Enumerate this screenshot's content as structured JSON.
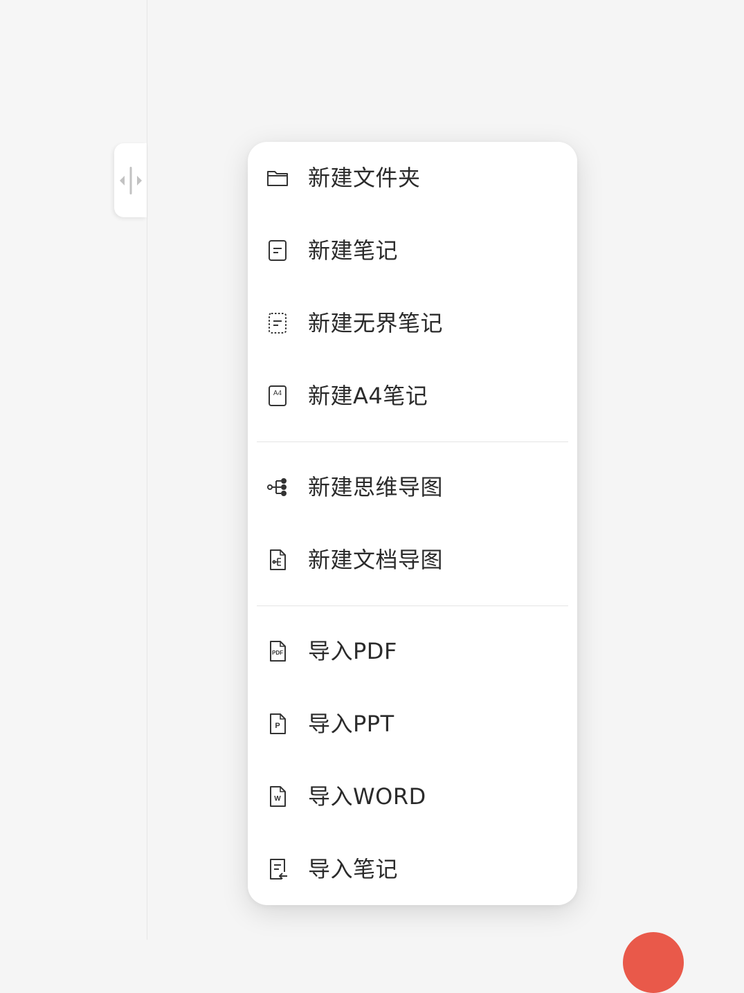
{
  "sidebar": {
    "handle_icon": "resize-handle-icon"
  },
  "menu": {
    "items": [
      {
        "label": "新建文件夹",
        "icon": "folder-icon"
      },
      {
        "label": "新建笔记",
        "icon": "note-icon"
      },
      {
        "label": "新建无界笔记",
        "icon": "borderless-note-icon"
      },
      {
        "label": "新建A4笔记",
        "icon": "a4-note-icon",
        "icon_text": "A4"
      },
      {
        "label": "新建思维导图",
        "icon": "mindmap-icon"
      },
      {
        "label": "新建文档导图",
        "icon": "doc-mindmap-icon"
      },
      {
        "label": "导入PDF",
        "icon": "pdf-file-icon",
        "icon_text": "PDF"
      },
      {
        "label": "导入PPT",
        "icon": "ppt-file-icon",
        "icon_text": "P"
      },
      {
        "label": "导入WORD",
        "icon": "word-file-icon",
        "icon_text": "W"
      },
      {
        "label": "导入笔记",
        "icon": "import-note-icon"
      }
    ]
  },
  "colors": {
    "fab": "#e9594a",
    "background": "#f5f5f5",
    "menu": "#ffffff"
  }
}
